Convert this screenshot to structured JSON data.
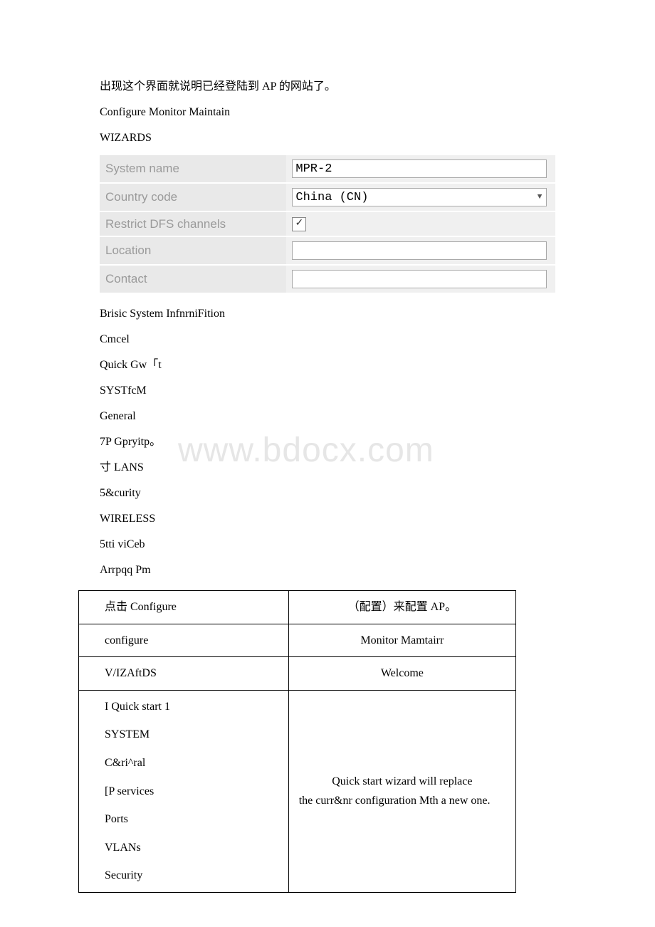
{
  "intro": "出现这个界面就说明已经登陆到 AP 的网站了。",
  "navline": "Configure Monitor Maintain",
  "wizards": "WIZARDS",
  "config_rows": {
    "system_name": {
      "label": "System name",
      "value": "MPR-2"
    },
    "country_code": {
      "label": "Country code",
      "value": "China (CN)"
    },
    "restrict_dfs": {
      "label": "Restrict DFS channels"
    },
    "location": {
      "label": "Location",
      "value": ""
    },
    "contact": {
      "label": "Contact",
      "value": ""
    }
  },
  "lines": {
    "l1": "Brisic System InfnrniFition",
    "l2": "Cmcel",
    "l3": "Quick Gw「t",
    "l4": "SYSTfcM",
    "l5": "General",
    "l6": "7P Gpryitp。",
    "l7": "寸 LANS",
    "l8": "5&curity",
    "l9": "WIRELESS",
    "l10": "5tti viCeb",
    "l11": "Arrpqq Pm"
  },
  "watermark": "www.bdocx.com",
  "table": {
    "r1c1": "点击 Configure",
    "r1c2": "（配置）来配置 AP。",
    "r2c1": "configure",
    "r2c2": "Monitor Mamtairr",
    "r3c1": "V/IZAftDS",
    "r3c2": "Welcome",
    "r4left": {
      "a": "I Quick start 1",
      "b": "SYSTEM",
      "c": "C&ri^ral",
      "d": "[P services",
      "e": "Ports",
      "f": "VLANs",
      "g": "Security"
    },
    "r4right_line1": "Quick start wizard will replace",
    "r4right_line2": "the curr&nr configuration Mth a new one."
  }
}
